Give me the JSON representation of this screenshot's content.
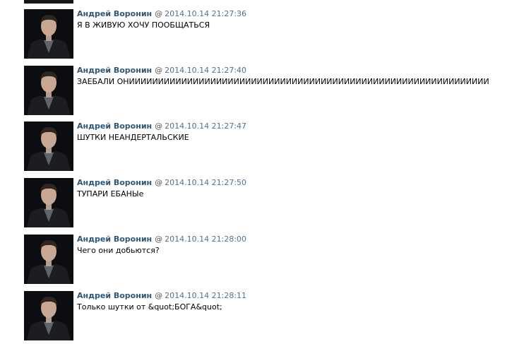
{
  "messages": [
    {
      "author": "Андрей Воронин",
      "at": "@",
      "timestamp": "2014.10.14 21:27:36",
      "text": "Я В ЖИВУЮ ХОЧУ ПООБЩАТЬСЯ"
    },
    {
      "author": "Андрей Воронин",
      "at": "@",
      "timestamp": "2014.10.14 21:27:40",
      "text": "ЗАЕБАЛИ ОНИИИИИИИИИИИИИИИИИИИИИИИИИИИИИИИИИИИИИИИИИИИИИИИИИИИИИИИИИИИИИИ"
    },
    {
      "author": "Андрей Воронин",
      "at": "@",
      "timestamp": "2014.10.14 21:27:47",
      "text": "ШУТКИ НЕАНДЕРТАЛЬСКИЕ"
    },
    {
      "author": "Андрей Воронин",
      "at": "@",
      "timestamp": "2014.10.14 21:27:50",
      "text": "ТУПАРИ ЕБАНЫе"
    },
    {
      "author": "Андрей Воронин",
      "at": "@",
      "timestamp": "2014.10.14 21:28:00",
      "text": "Чего они добьются?"
    },
    {
      "author": "Андрей Воронин",
      "at": "@",
      "timestamp": "2014.10.14 21:28:11",
      "text": "Только шутки от &quot;БОГА&quot;"
    }
  ]
}
